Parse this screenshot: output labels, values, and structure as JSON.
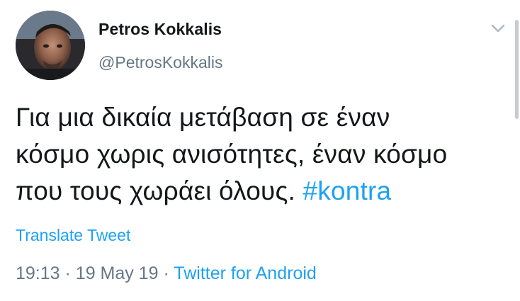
{
  "author": {
    "name": "Petros Kokkalis",
    "handle": "@PetrosKokkalis"
  },
  "tweet": {
    "line1": "Για μια δικαία μετάβαση σε έναν",
    "line2": "κόσμο χωρις ανισότητες, έναν κόσμο",
    "line3": "που τους χωράει όλους.",
    "hashtag": "#kontra"
  },
  "actions": {
    "translate_label": "Translate Tweet"
  },
  "meta": {
    "time": "19:13",
    "separator": "·",
    "date": "19 May 19",
    "source": "Twitter for Android"
  },
  "colors": {
    "link": "#1da1f2",
    "secondary": "#657786",
    "text": "#14171a"
  },
  "icons": {
    "menu": "chevron-down-icon"
  }
}
